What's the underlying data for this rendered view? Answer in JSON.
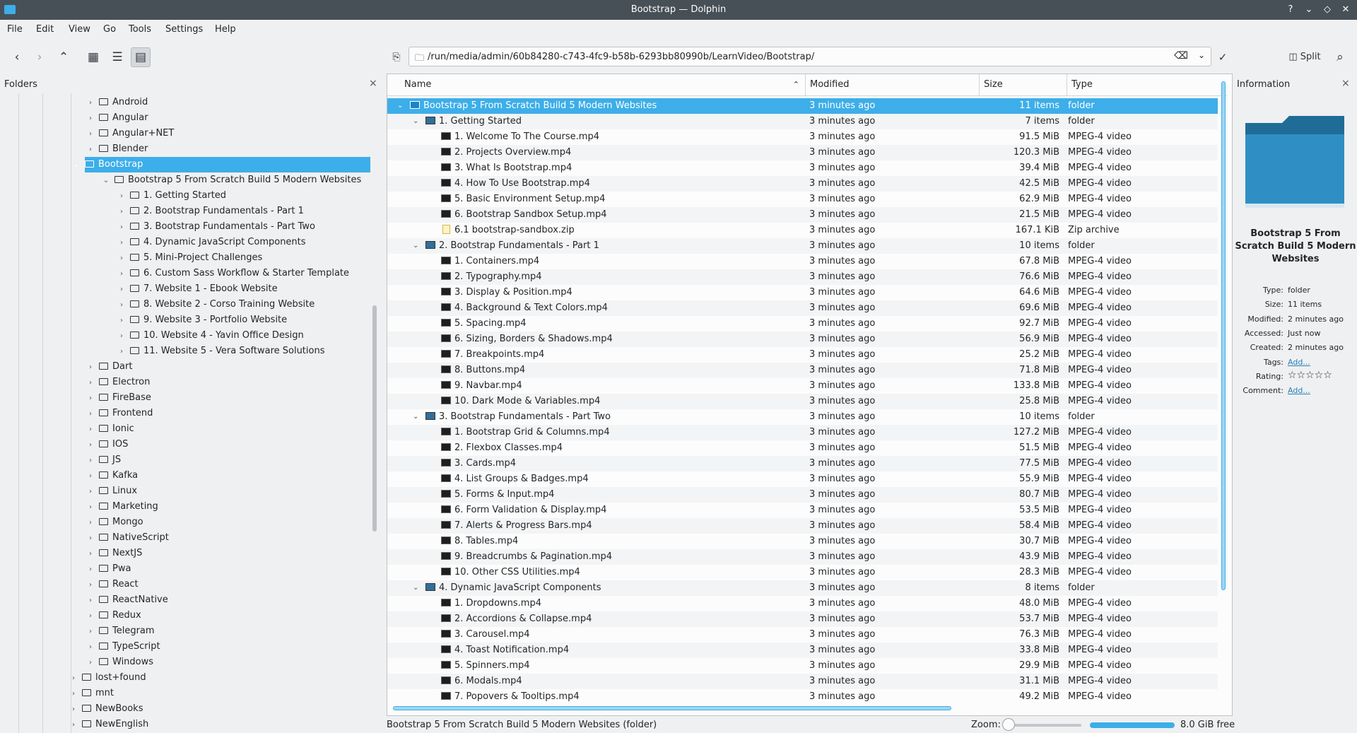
{
  "window": {
    "title": "Bootstrap — Dolphin"
  },
  "menu": [
    "File",
    "Edit",
    "View",
    "Go",
    "Tools",
    "Settings",
    "Help"
  ],
  "toolbar": {
    "location": "/run/media/admin/60b84280-c743-4fc9-b58b-6293bb80990b/LearnVideo/Bootstrap/",
    "split_label": "Split"
  },
  "folders_panel": {
    "title": "Folders",
    "tree": [
      {
        "label": "Android",
        "level": 2,
        "expanded": false
      },
      {
        "label": "Angular",
        "level": 2,
        "expanded": false
      },
      {
        "label": "Angular+NET",
        "level": 2,
        "expanded": false
      },
      {
        "label": "Blender",
        "level": 2,
        "expanded": false
      },
      {
        "label": "Bootstrap",
        "level": 2,
        "expanded": true,
        "selected": true
      },
      {
        "label": "Bootstrap 5 From Scratch  Build 5 Modern Websites",
        "level": 3,
        "expanded": true
      },
      {
        "label": "1. Getting Started",
        "level": 4,
        "expanded": false
      },
      {
        "label": "2. Bootstrap Fundamentals - Part 1",
        "level": 4,
        "expanded": false
      },
      {
        "label": "3. Bootstrap Fundamentals - Part Two",
        "level": 4,
        "expanded": false
      },
      {
        "label": "4. Dynamic JavaScript Components",
        "level": 4,
        "expanded": false
      },
      {
        "label": "5. Mini-Project Challenges",
        "level": 4,
        "expanded": false
      },
      {
        "label": "6. Custom Sass Workflow & Starter Template",
        "level": 4,
        "expanded": false
      },
      {
        "label": "7. Website 1 - Ebook Website",
        "level": 4,
        "expanded": false
      },
      {
        "label": "8. Website 2 - Corso Training Website",
        "level": 4,
        "expanded": false
      },
      {
        "label": "9. Website 3 - Portfolio Website",
        "level": 4,
        "expanded": false
      },
      {
        "label": "10. Website 4 - Yavin Office Design",
        "level": 4,
        "expanded": false
      },
      {
        "label": "11. Website 5 - Vera Software Solutions",
        "level": 4,
        "expanded": false
      },
      {
        "label": "Dart",
        "level": 2,
        "expanded": false
      },
      {
        "label": "Electron",
        "level": 2,
        "expanded": false
      },
      {
        "label": "FireBase",
        "level": 2,
        "expanded": false
      },
      {
        "label": "Frontend",
        "level": 2,
        "expanded": false
      },
      {
        "label": "Ionic",
        "level": 2,
        "expanded": false
      },
      {
        "label": "IOS",
        "level": 2,
        "expanded": false
      },
      {
        "label": "JS",
        "level": 2,
        "expanded": false
      },
      {
        "label": "Kafka",
        "level": 2,
        "expanded": false
      },
      {
        "label": "Linux",
        "level": 2,
        "expanded": false
      },
      {
        "label": "Marketing",
        "level": 2,
        "expanded": false
      },
      {
        "label": "Mongo",
        "level": 2,
        "expanded": false
      },
      {
        "label": "NativeScript",
        "level": 2,
        "expanded": false
      },
      {
        "label": "NextJS",
        "level": 2,
        "expanded": false
      },
      {
        "label": "Pwa",
        "level": 2,
        "expanded": false
      },
      {
        "label": "React",
        "level": 2,
        "expanded": false
      },
      {
        "label": "ReactNative",
        "level": 2,
        "expanded": false
      },
      {
        "label": "Redux",
        "level": 2,
        "expanded": false
      },
      {
        "label": "Telegram",
        "level": 2,
        "expanded": false
      },
      {
        "label": "TypeScript",
        "level": 2,
        "expanded": false
      },
      {
        "label": "Windows",
        "level": 2,
        "expanded": false
      },
      {
        "label": "lost+found",
        "level": 1,
        "expanded": false
      },
      {
        "label": "mnt",
        "level": 1,
        "expanded": false
      },
      {
        "label": "NewBooks",
        "level": 1,
        "expanded": false
      },
      {
        "label": "NewEnglish",
        "level": 1,
        "expanded": false
      }
    ]
  },
  "details": {
    "columns": [
      "Name",
      "Modified",
      "Size",
      "Type"
    ],
    "rows": [
      {
        "name": "Bootstrap 5 From Scratch  Build 5 Modern Websites",
        "modified": "3 minutes ago",
        "size": "11 items",
        "type": "folder",
        "level": 0,
        "kind": "folder",
        "expanded": true,
        "selected": true
      },
      {
        "name": "1. Getting Started",
        "modified": "3 minutes ago",
        "size": "7 items",
        "type": "folder",
        "level": 1,
        "kind": "folder",
        "expanded": true
      },
      {
        "name": "1. Welcome To The Course.mp4",
        "modified": "3 minutes ago",
        "size": "91.5 MiB",
        "type": "MPEG-4 video",
        "level": 2,
        "kind": "video"
      },
      {
        "name": "2. Projects Overview.mp4",
        "modified": "3 minutes ago",
        "size": "120.3 MiB",
        "type": "MPEG-4 video",
        "level": 2,
        "kind": "video"
      },
      {
        "name": "3. What Is Bootstrap.mp4",
        "modified": "3 minutes ago",
        "size": "39.4 MiB",
        "type": "MPEG-4 video",
        "level": 2,
        "kind": "video"
      },
      {
        "name": "4. How To Use Bootstrap.mp4",
        "modified": "3 minutes ago",
        "size": "42.5 MiB",
        "type": "MPEG-4 video",
        "level": 2,
        "kind": "video"
      },
      {
        "name": "5. Basic Environment Setup.mp4",
        "modified": "3 minutes ago",
        "size": "62.9 MiB",
        "type": "MPEG-4 video",
        "level": 2,
        "kind": "video"
      },
      {
        "name": "6. Bootstrap Sandbox Setup.mp4",
        "modified": "3 minutes ago",
        "size": "21.5 MiB",
        "type": "MPEG-4 video",
        "level": 2,
        "kind": "video"
      },
      {
        "name": "6.1 bootstrap-sandbox.zip",
        "modified": "3 minutes ago",
        "size": "167.1 KiB",
        "type": "Zip archive",
        "level": 2,
        "kind": "zip"
      },
      {
        "name": "2. Bootstrap Fundamentals - Part 1",
        "modified": "3 minutes ago",
        "size": "10 items",
        "type": "folder",
        "level": 1,
        "kind": "folder",
        "expanded": true
      },
      {
        "name": "1. Containers.mp4",
        "modified": "3 minutes ago",
        "size": "67.8 MiB",
        "type": "MPEG-4 video",
        "level": 2,
        "kind": "video"
      },
      {
        "name": "2. Typography.mp4",
        "modified": "3 minutes ago",
        "size": "76.6 MiB",
        "type": "MPEG-4 video",
        "level": 2,
        "kind": "video"
      },
      {
        "name": "3. Display & Position.mp4",
        "modified": "3 minutes ago",
        "size": "64.6 MiB",
        "type": "MPEG-4 video",
        "level": 2,
        "kind": "video"
      },
      {
        "name": "4. Background & Text Colors.mp4",
        "modified": "3 minutes ago",
        "size": "69.6 MiB",
        "type": "MPEG-4 video",
        "level": 2,
        "kind": "video"
      },
      {
        "name": "5. Spacing.mp4",
        "modified": "3 minutes ago",
        "size": "92.7 MiB",
        "type": "MPEG-4 video",
        "level": 2,
        "kind": "video"
      },
      {
        "name": "6. Sizing, Borders & Shadows.mp4",
        "modified": "3 minutes ago",
        "size": "56.9 MiB",
        "type": "MPEG-4 video",
        "level": 2,
        "kind": "video"
      },
      {
        "name": "7. Breakpoints.mp4",
        "modified": "3 minutes ago",
        "size": "25.2 MiB",
        "type": "MPEG-4 video",
        "level": 2,
        "kind": "video"
      },
      {
        "name": "8. Buttons.mp4",
        "modified": "3 minutes ago",
        "size": "71.8 MiB",
        "type": "MPEG-4 video",
        "level": 2,
        "kind": "video"
      },
      {
        "name": "9. Navbar.mp4",
        "modified": "3 minutes ago",
        "size": "133.8 MiB",
        "type": "MPEG-4 video",
        "level": 2,
        "kind": "video"
      },
      {
        "name": "10. Dark Mode & Variables.mp4",
        "modified": "3 minutes ago",
        "size": "25.8 MiB",
        "type": "MPEG-4 video",
        "level": 2,
        "kind": "video"
      },
      {
        "name": "3. Bootstrap Fundamentals - Part Two",
        "modified": "3 minutes ago",
        "size": "10 items",
        "type": "folder",
        "level": 1,
        "kind": "folder",
        "expanded": true
      },
      {
        "name": "1. Bootstrap Grid & Columns.mp4",
        "modified": "3 minutes ago",
        "size": "127.2 MiB",
        "type": "MPEG-4 video",
        "level": 2,
        "kind": "video"
      },
      {
        "name": "2. Flexbox Classes.mp4",
        "modified": "3 minutes ago",
        "size": "51.5 MiB",
        "type": "MPEG-4 video",
        "level": 2,
        "kind": "video"
      },
      {
        "name": "3. Cards.mp4",
        "modified": "3 minutes ago",
        "size": "77.5 MiB",
        "type": "MPEG-4 video",
        "level": 2,
        "kind": "video"
      },
      {
        "name": "4. List Groups & Badges.mp4",
        "modified": "3 minutes ago",
        "size": "55.9 MiB",
        "type": "MPEG-4 video",
        "level": 2,
        "kind": "video"
      },
      {
        "name": "5. Forms & Input.mp4",
        "modified": "3 minutes ago",
        "size": "80.7 MiB",
        "type": "MPEG-4 video",
        "level": 2,
        "kind": "video"
      },
      {
        "name": "6. Form Validation & Display.mp4",
        "modified": "3 minutes ago",
        "size": "53.5 MiB",
        "type": "MPEG-4 video",
        "level": 2,
        "kind": "video"
      },
      {
        "name": "7. Alerts & Progress Bars.mp4",
        "modified": "3 minutes ago",
        "size": "58.4 MiB",
        "type": "MPEG-4 video",
        "level": 2,
        "kind": "video"
      },
      {
        "name": "8. Tables.mp4",
        "modified": "3 minutes ago",
        "size": "30.7 MiB",
        "type": "MPEG-4 video",
        "level": 2,
        "kind": "video"
      },
      {
        "name": "9. Breadcrumbs & Pagination.mp4",
        "modified": "3 minutes ago",
        "size": "43.9 MiB",
        "type": "MPEG-4 video",
        "level": 2,
        "kind": "video"
      },
      {
        "name": "10. Other CSS Utilities.mp4",
        "modified": "3 minutes ago",
        "size": "28.3 MiB",
        "type": "MPEG-4 video",
        "level": 2,
        "kind": "video"
      },
      {
        "name": "4. Dynamic JavaScript Components",
        "modified": "3 minutes ago",
        "size": "8 items",
        "type": "folder",
        "level": 1,
        "kind": "folder",
        "expanded": true
      },
      {
        "name": "1. Dropdowns.mp4",
        "modified": "3 minutes ago",
        "size": "48.0 MiB",
        "type": "MPEG-4 video",
        "level": 2,
        "kind": "video"
      },
      {
        "name": "2. Accordions & Collapse.mp4",
        "modified": "3 minutes ago",
        "size": "53.7 MiB",
        "type": "MPEG-4 video",
        "level": 2,
        "kind": "video"
      },
      {
        "name": "3. Carousel.mp4",
        "modified": "3 minutes ago",
        "size": "76.3 MiB",
        "type": "MPEG-4 video",
        "level": 2,
        "kind": "video"
      },
      {
        "name": "4. Toast Notification.mp4",
        "modified": "3 minutes ago",
        "size": "33.8 MiB",
        "type": "MPEG-4 video",
        "level": 2,
        "kind": "video"
      },
      {
        "name": "5. Spinners.mp4",
        "modified": "3 minutes ago",
        "size": "29.9 MiB",
        "type": "MPEG-4 video",
        "level": 2,
        "kind": "video"
      },
      {
        "name": "6. Modals.mp4",
        "modified": "3 minutes ago",
        "size": "31.1 MiB",
        "type": "MPEG-4 video",
        "level": 2,
        "kind": "video"
      },
      {
        "name": "7. Popovers & Tooltips.mp4",
        "modified": "3 minutes ago",
        "size": "49.2 MiB",
        "type": "MPEG-4 video",
        "level": 2,
        "kind": "video"
      }
    ]
  },
  "info_panel": {
    "title": "Information",
    "name": "Bootstrap 5 From Scratch  Build 5 Modern Websites",
    "fields": [
      {
        "label": "Type:",
        "value": "folder"
      },
      {
        "label": "Size:",
        "value": "11 items"
      },
      {
        "label": "Modified:",
        "value": "2 minutes ago"
      },
      {
        "label": "Accessed:",
        "value": "Just now"
      },
      {
        "label": "Created:",
        "value": "2 minutes ago"
      },
      {
        "label": "Tags:",
        "value": "Add...",
        "link": true
      },
      {
        "label": "Rating:",
        "value": "☆☆☆☆☆",
        "stars": true
      },
      {
        "label": "Comment:",
        "value": "Add...",
        "link": true
      }
    ]
  },
  "statusbar": {
    "text": "Bootstrap 5 From Scratch  Build 5 Modern Websites (folder)",
    "zoom_label": "Zoom:",
    "free_space": "8.0 GiB free"
  },
  "colors": {
    "selection": "#3daee9",
    "titlebar": "#475057",
    "folder_icon": "#2f6f9a"
  }
}
